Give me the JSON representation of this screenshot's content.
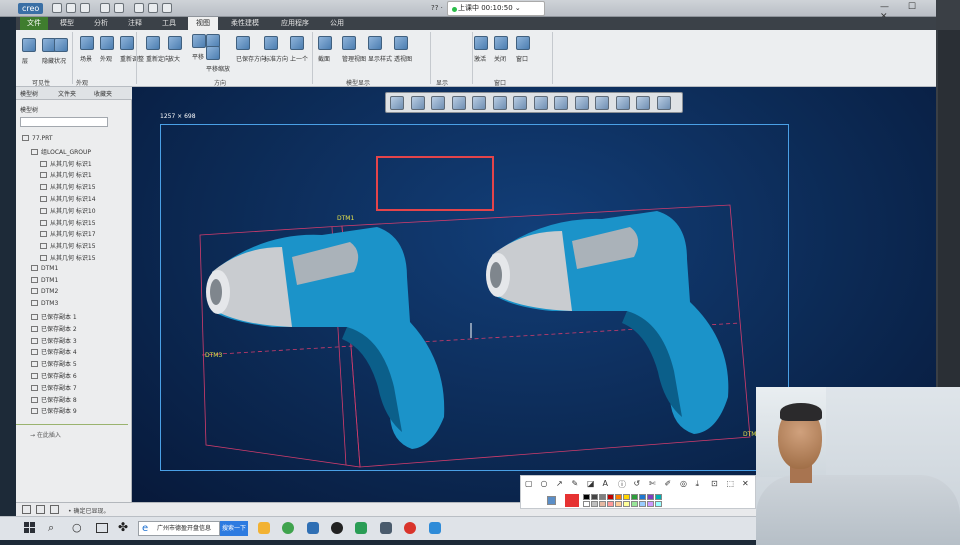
{
  "app": {
    "logo": "creo",
    "title_fragment": "?? ·"
  },
  "meeting": {
    "status": "上课中 00:10:50",
    "arrow": "⌄"
  },
  "window_controls": "— ☐ ✕",
  "ribbon_tabs": [
    "文件",
    "模型",
    "分析",
    "注释",
    "工具",
    "视图",
    "柔性建模",
    "应用程序",
    "公用"
  ],
  "ribbon_active": "视图",
  "ribbon": {
    "groups": [
      "可见性",
      "外观",
      "方向",
      "模型显示",
      "显示",
      "窗口"
    ],
    "labels": [
      "层",
      "隐藏",
      "状况",
      "场景",
      "外观",
      "重新调整",
      "重新定向",
      "放大",
      "平移",
      "缩小",
      "平移缩放",
      "已保存方向",
      "标准方向",
      "上一个",
      "截面",
      "管理视图",
      "显示样式",
      "透视图",
      "激活",
      "关闭",
      "窗口"
    ]
  },
  "left_panel": {
    "tabs": [
      "模型树",
      "文件夹",
      "收藏夹"
    ],
    "tree_header": "模型树",
    "items": [
      {
        "label": "77.PRT",
        "indent": 0
      },
      {
        "label": "组LOCAL_GROUP",
        "indent": 1
      },
      {
        "label": "从其几何 标识1",
        "indent": 2
      },
      {
        "label": "从其几何 标识1",
        "indent": 2
      },
      {
        "label": "从其几何 标识15",
        "indent": 2
      },
      {
        "label": "从其几何 标识14",
        "indent": 2
      },
      {
        "label": "从其几何 标识10",
        "indent": 2
      },
      {
        "label": "从其几何 标识15",
        "indent": 2
      },
      {
        "label": "从其几何 标识17",
        "indent": 2
      },
      {
        "label": "从其几何 标识15",
        "indent": 2
      },
      {
        "label": "从其几何 标识15",
        "indent": 2
      },
      {
        "label": "DTM1",
        "indent": 1
      },
      {
        "label": "DTM1",
        "indent": 1
      },
      {
        "label": "DTM2",
        "indent": 1
      },
      {
        "label": "DTM3",
        "indent": 1
      },
      {
        "label": "已保存副本 1",
        "indent": 1
      },
      {
        "label": "已保存副本 2",
        "indent": 1
      },
      {
        "label": "已保存副本 3",
        "indent": 1
      },
      {
        "label": "已保存副本 4",
        "indent": 1
      },
      {
        "label": "已保存副本 5",
        "indent": 1
      },
      {
        "label": "已保存副本 6",
        "indent": 1
      },
      {
        "label": "已保存副本 7",
        "indent": 1
      },
      {
        "label": "已保存副本 8",
        "indent": 1
      },
      {
        "label": "已保存副本 9",
        "indent": 1
      }
    ],
    "insert_here": "→ 在此插入"
  },
  "viewport": {
    "size_label": "1257 × 698",
    "datums": [
      "DTM1",
      "DTM3",
      "DTM"
    ]
  },
  "status_bar": {
    "text": "• 确定已显现。"
  },
  "taskbar": {
    "search_text": "广州市德盈开盘信息",
    "search_button": "搜索一下"
  },
  "annotation_palette": [
    "#000000",
    "#444444",
    "#7f7f7f",
    "#c00000",
    "#ff7f00",
    "#ffd700",
    "#2e9d3a",
    "#1f77d0",
    "#7f3fbf",
    "#00b0b0",
    "#ffffff",
    "#bfbfbf",
    "#e6b8a2",
    "#ff9999",
    "#ffcc99",
    "#ffff99",
    "#99e699",
    "#99ccff",
    "#cc99ff",
    "#99ffff"
  ],
  "annotation_current_color": "#e63232"
}
